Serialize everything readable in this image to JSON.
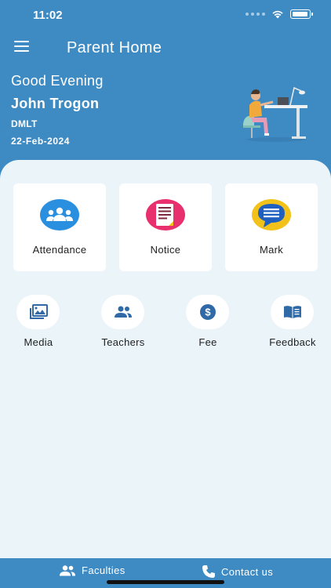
{
  "status_bar": {
    "time": "11:02"
  },
  "header": {
    "title": "Parent Home",
    "greeting": "Good Evening",
    "user_name": "John Trogon",
    "course": "DMLT",
    "date": "22-Feb-2024"
  },
  "cards": [
    {
      "label": "Attendance",
      "icon": "attendance-icon"
    },
    {
      "label": "Notice",
      "icon": "notice-icon"
    },
    {
      "label": "Mark",
      "icon": "mark-icon"
    }
  ],
  "quick_actions": [
    {
      "label": "Media",
      "icon": "media-icon"
    },
    {
      "label": "Teachers",
      "icon": "teachers-icon"
    },
    {
      "label": "Fee",
      "icon": "fee-icon"
    },
    {
      "label": "Feedback",
      "icon": "feedback-icon"
    }
  ],
  "bottom_nav": [
    {
      "label": "Faculties",
      "icon": "faculties-icon"
    },
    {
      "label": "Contact us",
      "icon": "phone-icon"
    }
  ],
  "colors": {
    "primary": "#3e8bc4",
    "content_bg": "#eaf4f9",
    "icon_blue": "#2f6aa6",
    "attendance_blue": "#2b8fe0",
    "notice_pink": "#e8306e",
    "mark_yellow": "#f2c21b"
  }
}
